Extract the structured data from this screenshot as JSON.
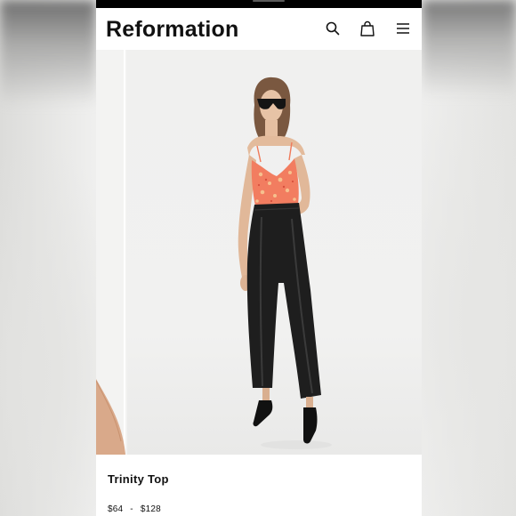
{
  "header": {
    "logo": "Reformation",
    "icons": [
      "search-icon",
      "bag-icon",
      "menu-icon"
    ]
  },
  "gallery": {
    "image": "model wearing coral leopard-print camisole with black leather straight-leg pants and black pointed heels"
  },
  "product": {
    "name": "Trinity Top",
    "price_low": "$64",
    "price_separator": "-",
    "price_high": "$128"
  },
  "colors": {
    "text": "#111111",
    "top_print": "#f07a5a",
    "pants": "#1e1e1e"
  }
}
